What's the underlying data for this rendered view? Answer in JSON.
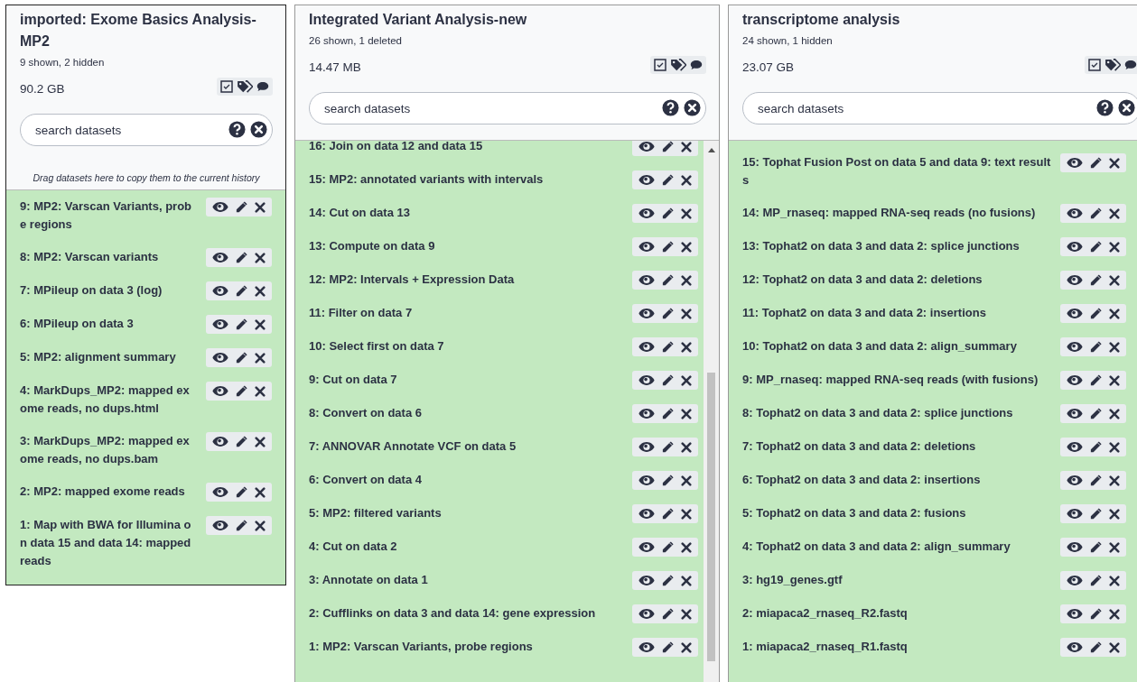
{
  "histories": [
    {
      "title": "imported: Exome Basics Analysis-MP2",
      "summary": "9 shown, 2 hidden",
      "size": "90.2 GB",
      "search": {
        "placeholder": "search datasets"
      },
      "drop_hint": "Drag datasets here to copy them to the current history",
      "scrollable": false,
      "datasets": [
        {
          "name": "9: MP2: Varscan Variants, probe regions"
        },
        {
          "name": "8: MP2: Varscan variants"
        },
        {
          "name": "7: MPileup on data 3 (log)"
        },
        {
          "name": "6: MPileup on data 3"
        },
        {
          "name": "5: MP2: alignment summary"
        },
        {
          "name": "4: MarkDups_MP2: mapped exome reads, no dups.html"
        },
        {
          "name": "3: MarkDups_MP2: mapped exome reads, no dups.bam"
        },
        {
          "name": "2: MP2: mapped exome reads"
        },
        {
          "name": "1: Map with BWA for Illumina on data 15 and data 14: mapped reads"
        }
      ]
    },
    {
      "title": "Integrated Variant Analysis-new",
      "summary": "26 shown, 1 deleted",
      "size": "14.47 MB",
      "search": {
        "placeholder": "search datasets"
      },
      "scrollable": true,
      "datasets": [
        {
          "name": "16: Join on data 12 and data 15"
        },
        {
          "name": "15: MP2: annotated variants with intervals"
        },
        {
          "name": "14: Cut on data 13"
        },
        {
          "name": "13: Compute on data 9"
        },
        {
          "name": "12: MP2: Intervals + Expression Data"
        },
        {
          "name": "11: Filter on data 7"
        },
        {
          "name": "10: Select first on data 7"
        },
        {
          "name": "9: Cut on data 7"
        },
        {
          "name": "8: Convert on data 6"
        },
        {
          "name": "7: ANNOVAR Annotate VCF on data 5"
        },
        {
          "name": "6: Convert on data 4"
        },
        {
          "name": "5: MP2: filtered variants"
        },
        {
          "name": "4: Cut on data 2"
        },
        {
          "name": "3: Annotate on data 1"
        },
        {
          "name": "2: Cufflinks on data 3 and data 14: gene expression"
        },
        {
          "name": "1: MP2: Varscan Variants, probe regions"
        }
      ]
    },
    {
      "title": "transcriptome analysis",
      "summary": "24 shown, 1 hidden",
      "size": "23.07 GB",
      "search": {
        "placeholder": "search datasets"
      },
      "scrollable": false,
      "datasets": [
        {
          "name": "15: Tophat Fusion Post on data 5 and data 9: text results"
        },
        {
          "name": "14: MP_rnaseq: mapped RNA-seq reads (no fusions)"
        },
        {
          "name": "13: Tophat2 on data 3 and data 2: splice junctions"
        },
        {
          "name": "12: Tophat2 on data 3 and data 2: deletions"
        },
        {
          "name": "11: Tophat2 on data 3 and data 2: insertions"
        },
        {
          "name": "10: Tophat2 on data 3 and data 2: align_summary"
        },
        {
          "name": "9: MP_rnaseq: mapped RNA-seq reads (with fusions)"
        },
        {
          "name": "8: Tophat2 on data 3 and data 2: splice junctions"
        },
        {
          "name": "7: Tophat2 on data 3 and data 2: deletions"
        },
        {
          "name": "6: Tophat2 on data 3 and data 2: insertions"
        },
        {
          "name": "5: Tophat2 on data 3 and data 2: fusions"
        },
        {
          "name": "4: Tophat2 on data 3 and data 2: align_summary"
        },
        {
          "name": "3: hg19_genes.gtf"
        },
        {
          "name": "2: miapaca2_rnaseq_R2.fastq"
        },
        {
          "name": "1: miapaca2_rnaseq_R1.fastq"
        }
      ]
    }
  ]
}
